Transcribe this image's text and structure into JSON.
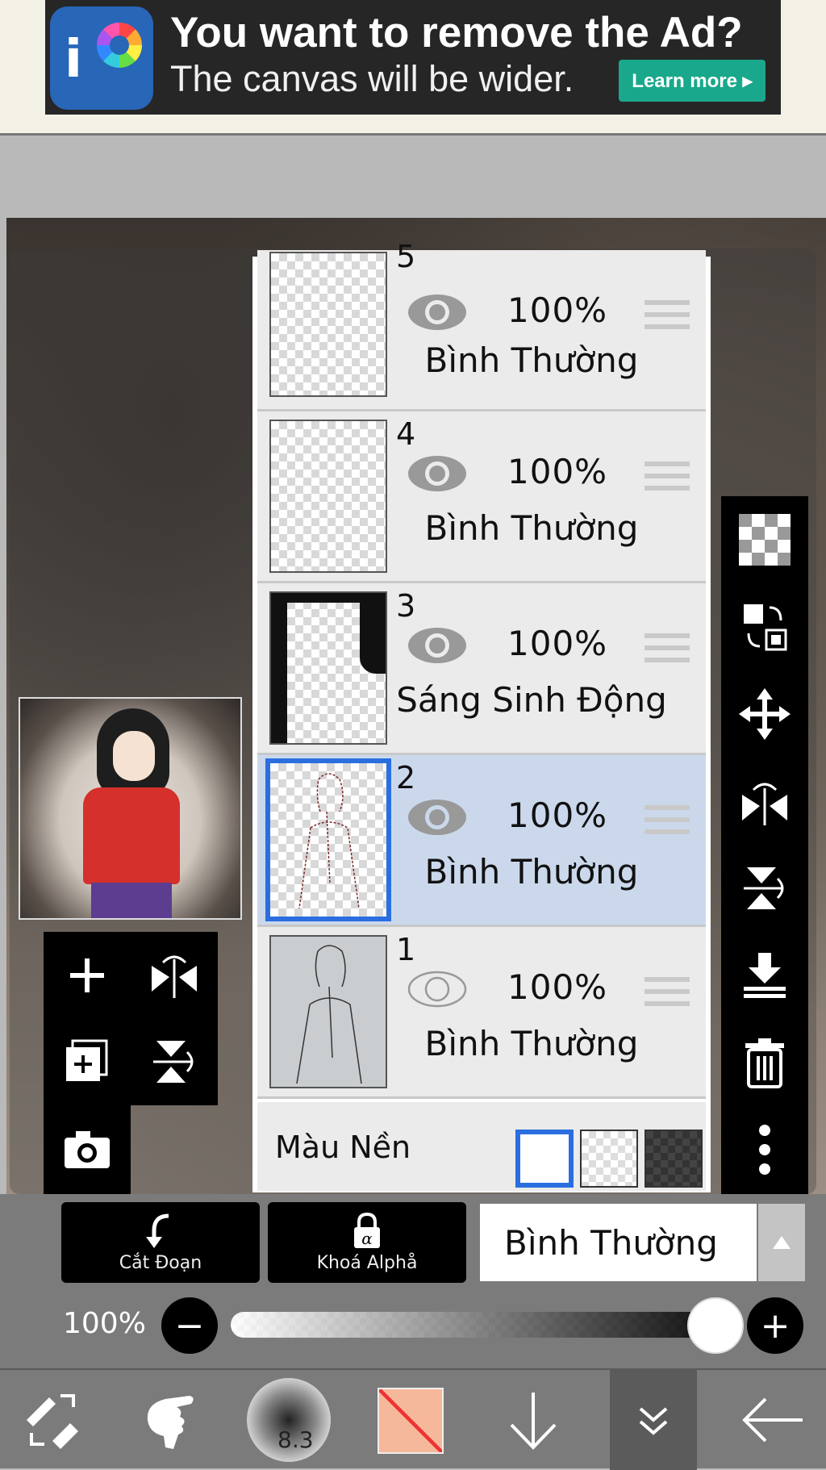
{
  "ad": {
    "title": "You want to remove the Ad?",
    "subtitle": "The canvas will be wider.",
    "button": "Learn more ▸"
  },
  "layers": [
    {
      "num": "5",
      "opacity": "100%",
      "mode": "Bình Thường",
      "visible": true,
      "selected": false
    },
    {
      "num": "4",
      "opacity": "100%",
      "mode": "Bình Thường",
      "visible": true,
      "selected": false
    },
    {
      "num": "3",
      "opacity": "100%",
      "mode": "Sáng Sinh Động",
      "visible": true,
      "selected": false
    },
    {
      "num": "2",
      "opacity": "100%",
      "mode": "Bình Thường",
      "visible": true,
      "selected": true
    },
    {
      "num": "1",
      "opacity": "100%",
      "mode": "Bình Thường",
      "visible": false,
      "selected": false
    }
  ],
  "background": {
    "label": "Màu Nền"
  },
  "controls": {
    "clipping_label": "Cắt Đoạn",
    "alpha_lock_label": "Khoá Alphå",
    "blend_mode": "Bình Thường",
    "opacity_label": "100%",
    "opacity_value": 1.0,
    "minus": "−",
    "plus": "+"
  },
  "toolbar": {
    "brush_size": "8.3",
    "colors": {
      "primary": "#f6b89a",
      "accent": "#2a6ee0"
    }
  },
  "icons": {
    "left_tools": [
      "add-layer-icon",
      "flip-horizontal-icon",
      "duplicate-layer-icon",
      "flip-vertical-icon",
      "camera-icon"
    ],
    "right_tools": [
      "transparency-icon",
      "swap-icon",
      "move-icon",
      "flip-horizontal-icon",
      "flip-vertical-icon",
      "merge-down-icon",
      "delete-icon",
      "more-icon"
    ],
    "toolbar": [
      "tool-switch-icon",
      "finger-icon",
      "brush-size",
      "color-swatch",
      "arrow-down-icon",
      "double-chevron-icon",
      "back-arrow-icon"
    ]
  }
}
